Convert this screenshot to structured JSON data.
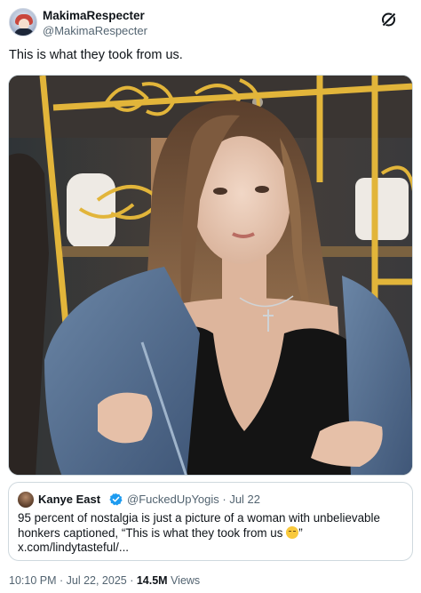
{
  "author": {
    "display_name": "MakimaRespecter",
    "handle": "@MakimaRespecter"
  },
  "tweet": {
    "text": "This is what they took from us."
  },
  "photo": {
    "description_icon": "photo"
  },
  "quoted": {
    "display_name": "Kanye East",
    "handle_date": "@FuckedUpYogis · Jul 22",
    "text_main": "95 percent of  nostalgia is just a picture of a woman with unbelievable honkers captioned, “This is what they took from us ",
    "text_end": "”",
    "link": "x.com/lindytasteful/..."
  },
  "meta": {
    "time": "10:10 PM · Jul 22, 2025 · ",
    "views_count": "14.5M",
    "views_label": " Views"
  },
  "colors": {
    "text": "#0f1419",
    "secondary": "#536471",
    "border": "#cfd9de",
    "verified": "#1d9bf0",
    "frame_gold": "#e2b53a"
  }
}
